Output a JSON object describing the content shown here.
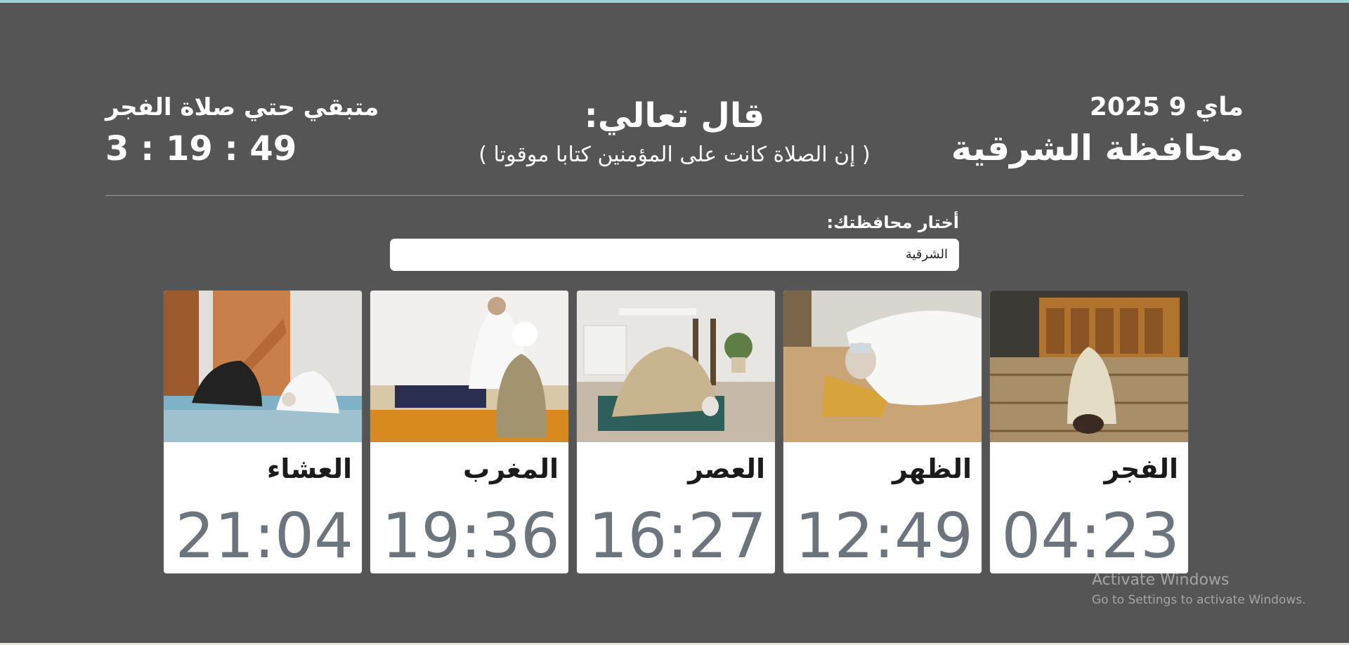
{
  "header": {
    "date": "ماي 9 2025",
    "region": "محافظة الشرقية",
    "verse_title": "قال تعالي:",
    "verse_text": "( إن الصلاة كانت على المؤمنين كتابا موقوتا )",
    "countdown_label": "متبقي حتي صلاة الفجر",
    "countdown_value": "3 : 19 : 49"
  },
  "selector": {
    "label": "أختار محافظتك:",
    "selected": "الشرقية"
  },
  "prayers": [
    {
      "name": "الفجر",
      "time": "04:23",
      "icon": "prayer-photo-fajr"
    },
    {
      "name": "الظهر",
      "time": "12:49",
      "icon": "prayer-photo-dhuhr"
    },
    {
      "name": "العصر",
      "time": "16:27",
      "icon": "prayer-photo-asr"
    },
    {
      "name": "المغرب",
      "time": "19:36",
      "icon": "prayer-photo-maghrib"
    },
    {
      "name": "العشاء",
      "time": "21:04",
      "icon": "prayer-photo-isha"
    }
  ],
  "watermark": {
    "line1": "Activate Windows",
    "line2": "Go to Settings to activate Windows."
  },
  "colors": {
    "background": "#555555",
    "card": "#ffffff",
    "time_text": "#6c757d"
  }
}
